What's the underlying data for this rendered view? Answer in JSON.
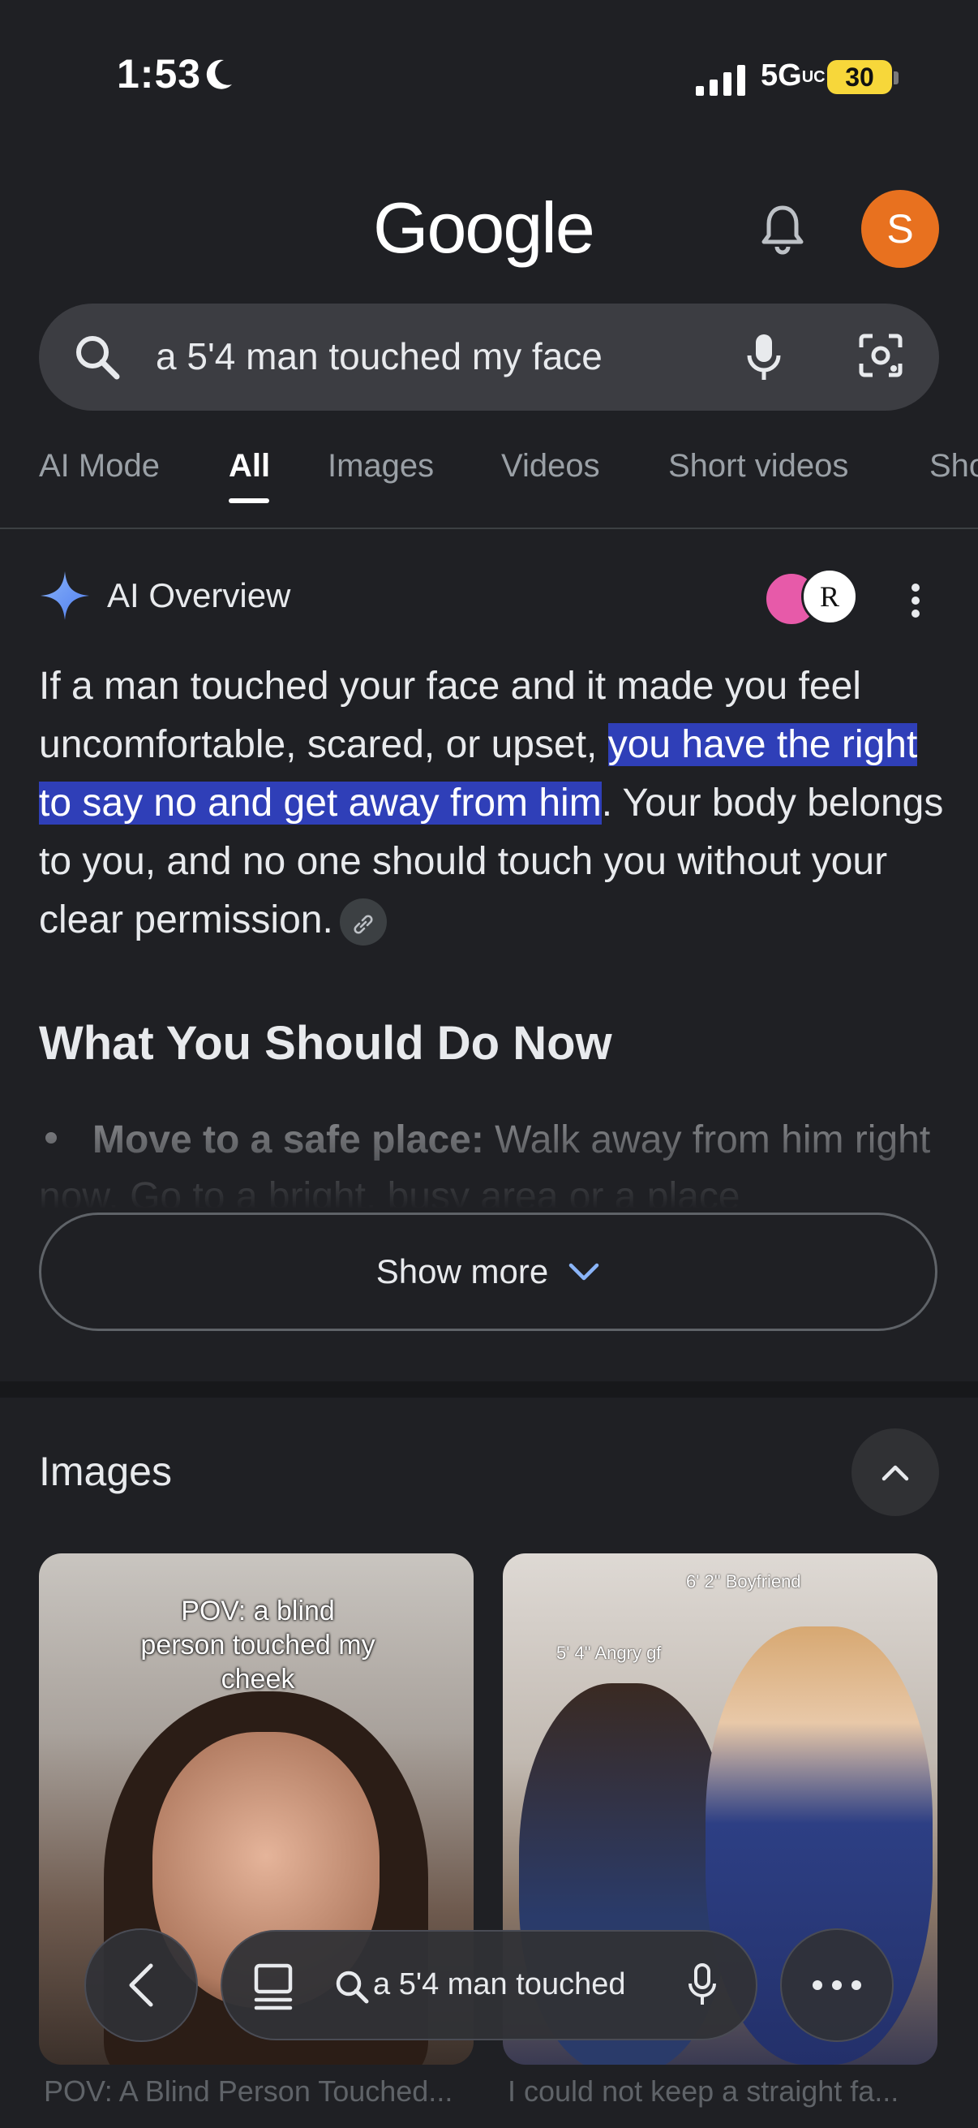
{
  "status_bar": {
    "time": "1:53",
    "network": "5G",
    "network_suffix": "UC",
    "battery": "30"
  },
  "header": {
    "logo": "Google",
    "avatar_letter": "S"
  },
  "search": {
    "query": "a 5'4 man touched my face"
  },
  "tabs": [
    {
      "label": "AI Mode",
      "active": false
    },
    {
      "label": "All",
      "active": true
    },
    {
      "label": "Images",
      "active": false
    },
    {
      "label": "Videos",
      "active": false
    },
    {
      "label": "Short videos",
      "active": false
    },
    {
      "label": "Sho",
      "active": false
    }
  ],
  "ai_overview": {
    "title": "AI Overview",
    "source_b_letter": "R",
    "text_before": "If a man touched your face and it made you feel uncomfortable, scared, or upset, ",
    "text_highlight": "you have the right to say no and get away from him",
    "text_after": ". Your body belongs to you, and no one should touch you without your clear permission.",
    "section_heading": "What You Should Do Now",
    "bullet_bold": "Move to a safe place:",
    "bullet_text": " Walk away from him right now. Go to a bright, busy area or a place",
    "show_more": "Show more"
  },
  "images": {
    "title": "Images",
    "items": [
      {
        "caption": "POV: a blind person touched my cheek",
        "label": "POV: A Blind Person Touched..."
      },
      {
        "caption_top": "6' 2\" Boyfriend",
        "caption_side": "5' 4\" Angry gf",
        "label": "I could not keep a straight fa..."
      }
    ]
  },
  "bottom_bar": {
    "query": "a 5'4 man touched"
  },
  "colors": {
    "background": "#1f2024",
    "highlight": "#2f3fb8",
    "avatar": "#e8711f",
    "battery": "#f7d73a"
  }
}
